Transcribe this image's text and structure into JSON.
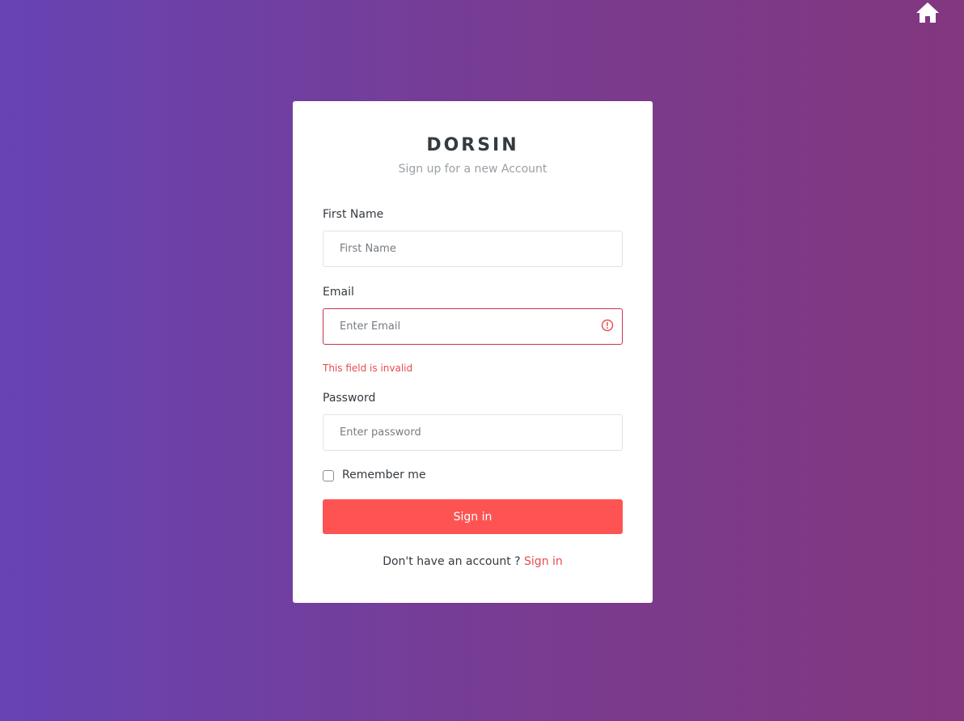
{
  "brand": "DORSIN",
  "subtitle": "Sign up for a new Account",
  "icons": {
    "home": "home-icon",
    "invalid": "error-circle-icon"
  },
  "form": {
    "first_name": {
      "label": "First Name",
      "placeholder": "First Name",
      "value": ""
    },
    "email": {
      "label": "Email",
      "placeholder": "Enter Email",
      "value": "",
      "error": "This field is invalid"
    },
    "password": {
      "label": "Password",
      "placeholder": "Enter password",
      "value": ""
    },
    "remember_me": {
      "label": "Remember me",
      "checked": false
    },
    "submit_label": "Sign in"
  },
  "footer": {
    "text": "Don't have an account ?",
    "link_label": "Sign in"
  },
  "colors": {
    "accent": "#fd5453",
    "error": "#e74c4c",
    "invalid_border": "#c8334d",
    "background_start": "#6743b3",
    "background_end": "#82377f"
  }
}
